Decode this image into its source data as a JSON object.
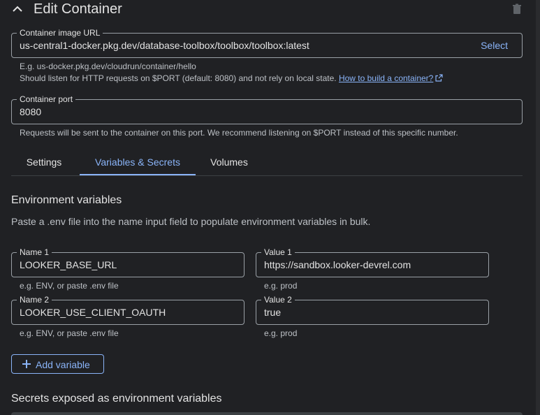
{
  "header": {
    "title": "Edit Container"
  },
  "image_url": {
    "label": "Container image URL",
    "value": "us-central1-docker.pkg.dev/database-toolbox/toolbox/toolbox:latest",
    "select_label": "Select",
    "hint_example": "E.g. us-docker.pkg.dev/cloudrun/container/hello",
    "hint_listen": "Should listen for HTTP requests on $PORT (default: 8080) and not rely on local state.",
    "hint_link": "How to build a container?"
  },
  "port": {
    "label": "Container port",
    "value": "8080",
    "hint": "Requests will be sent to the container on this port. We recommend listening on $PORT instead of this specific number."
  },
  "tabs": [
    {
      "label": "Settings",
      "active": false
    },
    {
      "label": "Variables & Secrets",
      "active": true
    },
    {
      "label": "Volumes",
      "active": false
    }
  ],
  "env": {
    "title": "Environment variables",
    "description": "Paste a .env file into the name input field to populate environment variables in bulk.",
    "rows": [
      {
        "name_label": "Name 1",
        "name_value": "LOOKER_BASE_URL",
        "name_hint": "e.g. ENV, or paste .env file",
        "value_label": "Value 1",
        "value_value": "https://sandbox.looker-devrel.com",
        "value_hint": "e.g. prod"
      },
      {
        "name_label": "Name 2",
        "name_value": "LOOKER_USE_CLIENT_OAUTH",
        "name_hint": "e.g. ENV, or paste .env file",
        "value_label": "Value 2",
        "value_value": "true",
        "value_hint": "e.g. prod"
      }
    ],
    "add_label": "Add variable"
  },
  "secrets": {
    "title": "Secrets exposed as environment variables"
  },
  "icons": {
    "collapse": "chevron-up-icon",
    "delete": "trash-icon",
    "external": "open-in-new-icon",
    "add": "plus-icon"
  },
  "colors": {
    "background": "#202124",
    "accent": "#8ab4f8",
    "outline": "#9aa0a6",
    "text": "#e3e3e3"
  }
}
